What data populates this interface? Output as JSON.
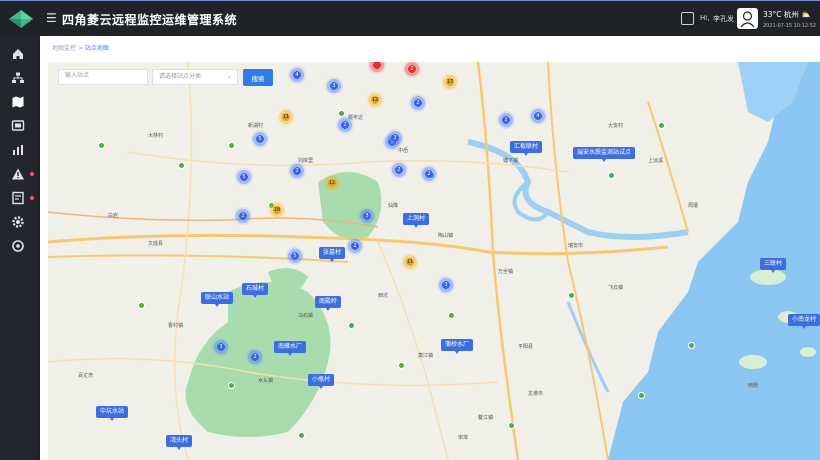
{
  "app": {
    "title": "四角菱云远程监控运维管理系统",
    "menu_icon": "menu-icon",
    "logo_icon": "diamond-logo-icon"
  },
  "header": {
    "fullscreen_icon": "fullscreen-icon",
    "greeting": "Hi,",
    "user_name": "李孔发",
    "weather": "33°C 杭州 ⛅",
    "datetime": "2021-07-15 10:12:52"
  },
  "sidebar": {
    "items": [
      {
        "icon": "home-icon",
        "alert": false
      },
      {
        "icon": "org-chart-icon",
        "alert": false
      },
      {
        "icon": "map-icon",
        "alert": false
      },
      {
        "icon": "monitor-icon",
        "alert": false
      },
      {
        "icon": "bar-chart-icon",
        "alert": false
      },
      {
        "icon": "warning-icon",
        "alert": true
      },
      {
        "icon": "report-icon",
        "alert": true
      },
      {
        "icon": "gear-icon",
        "alert": false
      },
      {
        "icon": "settings-icon",
        "alert": false
      }
    ]
  },
  "breadcrumb": {
    "root": "地图监控",
    "separator": ">",
    "current": "站点地图"
  },
  "filters": {
    "search_placeholder": "输入站点",
    "type_placeholder": "请选择站点分类",
    "search_button": "搜索"
  },
  "stations": [
    {
      "name": "汇板联村"
    },
    {
      "name": "瑞安水质监测站试点"
    },
    {
      "name": "上洞村"
    },
    {
      "name": "张墓村"
    },
    {
      "name": "石城村"
    },
    {
      "name": "联山水站"
    },
    {
      "name": "南殿岭"
    },
    {
      "name": "南雁水厂"
    },
    {
      "name": "小瓶村"
    },
    {
      "name": "蒲桥水厂"
    },
    {
      "name": "中坑水站"
    },
    {
      "name": "湾头村"
    },
    {
      "name": "三联村"
    },
    {
      "name": "小南龙村"
    }
  ],
  "clusters": [
    {
      "count": "4",
      "color": "blue"
    },
    {
      "count": "3",
      "color": "blue"
    },
    {
      "count": "",
      "color": "red"
    },
    {
      "count": "2",
      "color": "red"
    },
    {
      "count": "17",
      "color": "yellow"
    },
    {
      "count": "12",
      "color": "yellow"
    },
    {
      "count": "2",
      "color": "blue"
    },
    {
      "count": "11",
      "color": "yellow"
    },
    {
      "count": "2",
      "color": "blue"
    },
    {
      "count": "2",
      "color": "blue"
    },
    {
      "count": "4",
      "color": "blue"
    },
    {
      "count": "3",
      "color": "blue"
    },
    {
      "count": "5",
      "color": "blue"
    },
    {
      "count": "2",
      "color": "blue"
    },
    {
      "count": "5",
      "color": "blue"
    },
    {
      "count": "12",
      "color": "yellow"
    },
    {
      "count": "2",
      "color": "blue"
    },
    {
      "count": "18",
      "color": "yellow"
    },
    {
      "count": "3",
      "color": "blue"
    },
    {
      "count": "2",
      "color": "blue"
    },
    {
      "count": "5",
      "color": "blue"
    },
    {
      "count": "11",
      "color": "yellow"
    },
    {
      "count": "3",
      "color": "blue"
    },
    {
      "count": "3",
      "color": "blue"
    },
    {
      "count": "2",
      "color": "blue"
    },
    {
      "count": "2",
      "color": "blue"
    },
    {
      "count": "2",
      "color": "blue"
    },
    {
      "count": "3",
      "color": "blue"
    }
  ],
  "places": [
    "顺丰达",
    "大林村",
    "新湖村",
    "刘岸里",
    "中岙",
    "白岩",
    "大安村",
    "塘下镇",
    "上淡溪",
    "瑞安市",
    "文成县",
    "平阳县",
    "龙港市",
    "飞云镇",
    "万全镇",
    "鳌江镇",
    "水头镇",
    "南麂",
    "仙降",
    "陶山镇",
    "马屿镇",
    "曹村镇",
    "百丈漈",
    "西坑",
    "周壤",
    "萧江镇",
    "宋埠"
  ],
  "colors": {
    "accent": "#2f7ce8",
    "station": "#3c6ee0",
    "sea": "#8cc6f2",
    "forest": "#a8dcae",
    "road": "#f7c873"
  }
}
